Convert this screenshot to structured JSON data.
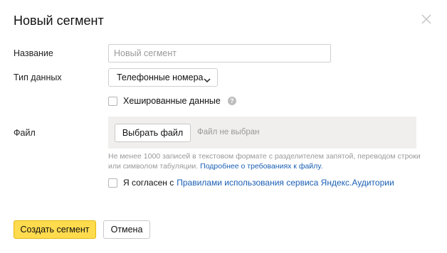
{
  "dialog": {
    "title": "Новый сегмент"
  },
  "form": {
    "name": {
      "label": "Название",
      "value": "",
      "placeholder": "Новый сегмент"
    },
    "data_type": {
      "label": "Тип данных",
      "selected": "Телефонные номера"
    },
    "hashed": {
      "label": "Хешированные данные",
      "checked": false,
      "help_glyph": "?"
    },
    "file": {
      "label": "Файл",
      "button_label": "Выбрать файл",
      "status": "Файл не выбран"
    },
    "hint": {
      "text": "Не менее 1000 записей в текстовом формате с разделителем запятой, переводом строки или символом табуляции.",
      "link_text": "Подробнее о требованиях к файлу."
    },
    "agree": {
      "checked": false,
      "text": "Я согласен с",
      "link_text": "Правилами использования сервиса Яндекс.Аудитории"
    }
  },
  "actions": {
    "create_label": "Создать сегмент",
    "cancel_label": "Отмена"
  },
  "colors": {
    "primary": "#ffdb4d",
    "link": "#1a5fb4",
    "file_area": "#f0efed"
  }
}
